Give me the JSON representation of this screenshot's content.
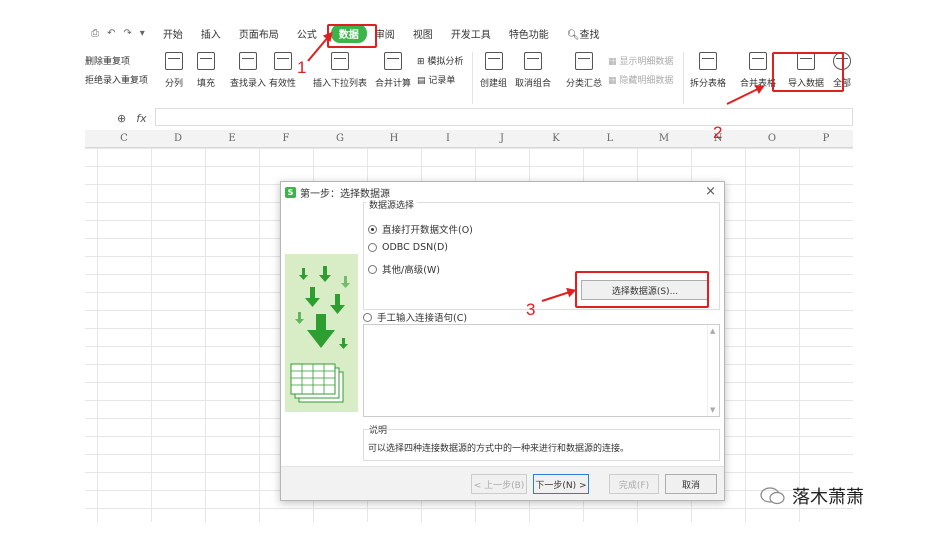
{
  "menu": {
    "quick_access": [
      "⎙",
      "↶",
      "↷",
      "▾"
    ],
    "tabs": [
      "开始",
      "插入",
      "页面布局",
      "公式",
      "数据",
      "审阅",
      "视图",
      "开发工具",
      "特色功能",
      "查找"
    ],
    "active_tab": "数据"
  },
  "ribbon": {
    "dup_remove": "删除重复项",
    "dup_reject": "拒绝录入重复项",
    "split": "分列",
    "fill": "填充",
    "lookup": "查找录入",
    "validity": "有效性",
    "dropdown": "插入下拉列表",
    "consolidate": "合并计算",
    "simulate": "模拟分析",
    "record": "记录单",
    "group": "创建组",
    "ungroup": "取消组合",
    "subtotal": "分类汇总",
    "show_detail": "显示明细数据",
    "hide_detail": "隐藏明细数据",
    "split_table": "拆分表格",
    "merge_table": "合并表格",
    "import": "导入数据",
    "all": "全部"
  },
  "formula_bar": {
    "zoom_icon": "⊕",
    "fx": "fx",
    "value": ""
  },
  "columns": [
    "C",
    "D",
    "E",
    "F",
    "G",
    "H",
    "I",
    "J",
    "K",
    "L",
    "M",
    "N",
    "O",
    "P"
  ],
  "annotations": {
    "n1": "1",
    "n2": "2",
    "n3": "3",
    "color": "#e02020"
  },
  "dialog": {
    "title": "第一步：选择数据源",
    "close": "×",
    "group_label": "数据源选择",
    "options": [
      "直接打开数据文件(O)",
      "ODBC DSN(D)",
      "其他/高级(W)"
    ],
    "selected": 0,
    "select_source_button": "选择数据源(S)...",
    "manual_option": "手工输入连接语句(C)",
    "description_label": "说明",
    "description": "可以选择四种连接数据源的方式中的一种来进行和数据源的连接。",
    "prev": "< 上一步(B)",
    "next": "下一步(N) >",
    "finish": "完成(F)",
    "cancel": "取消"
  },
  "watermark": "落木萧萧",
  "colors": {
    "accent_green": "#3bb44a",
    "side_panel": "#d8ecc6",
    "arrow_green": "#2f9e31"
  }
}
